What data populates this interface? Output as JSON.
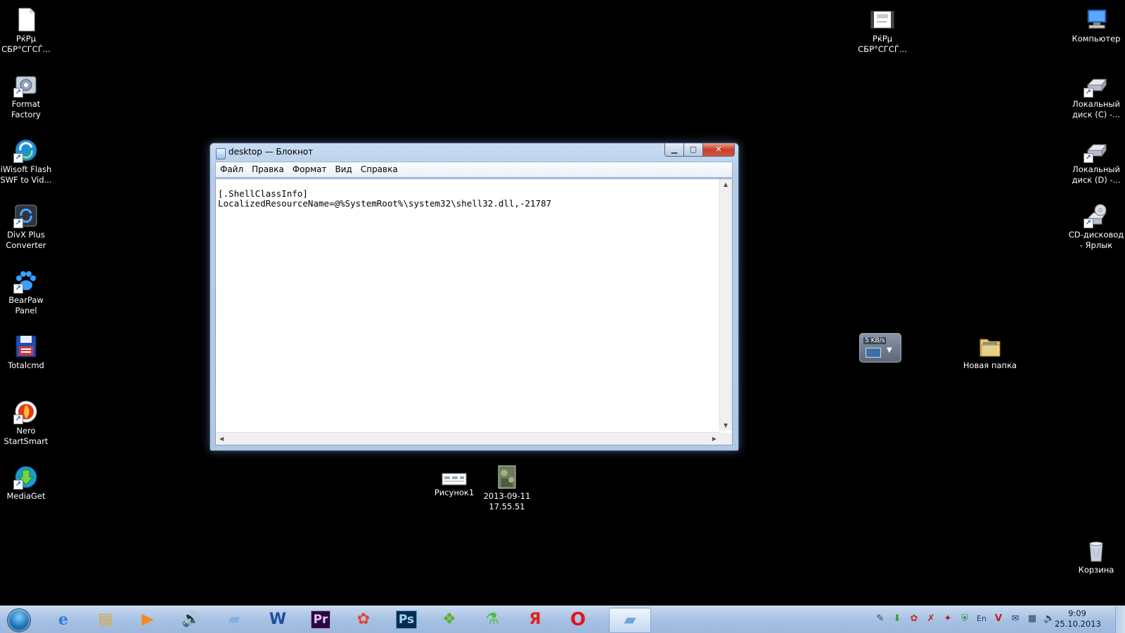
{
  "desktop_left": [
    {
      "label": "РќРµ СБР°СГСЃ...",
      "icon": "blank-file-icon"
    },
    {
      "label": "Format Factory",
      "icon": "format-factory-icon"
    },
    {
      "label": "iWisoft Flash SWF to Vid...",
      "icon": "iwisoft-icon"
    },
    {
      "label": "DivX Plus Converter",
      "icon": "divx-icon"
    },
    {
      "label": "BearPaw Panel",
      "icon": "bearpaw-icon"
    },
    {
      "label": "Totalcmd",
      "icon": "totalcmd-icon"
    },
    {
      "label": "Nero StartSmart",
      "icon": "nero-icon"
    },
    {
      "label": "MediaGet",
      "icon": "mediaget-icon"
    }
  ],
  "desktop_right": [
    {
      "label": "Компьютер",
      "icon": "computer-icon"
    },
    {
      "label": "Локальный диск (C) -...",
      "icon": "drive-c-icon"
    },
    {
      "label": "Локальный диск (D) -...",
      "icon": "drive-d-icon"
    },
    {
      "label": "CD-дисковод - Ярлык",
      "icon": "cd-drive-icon"
    },
    {
      "label": "Корзина",
      "icon": "recycle-bin-icon"
    }
  ],
  "desktop_misc": {
    "top_file": "РќРµ СБР°СГСЃ...",
    "new_folder": "Новая папка",
    "picture1": "Рисунок1",
    "photo": "2013-09-11 17.55.51",
    "gadget_speed": "5 KB/s"
  },
  "window": {
    "title": "desktop — Блокнот",
    "menu": [
      "Файл",
      "Правка",
      "Формат",
      "Вид",
      "Справка"
    ],
    "content_line1": "[.ShellClassInfo]",
    "content_line2": "LocalizedResourceName=@%SystemRoot%\\system32\\shell32.dll,-21787"
  },
  "taskbar": {
    "items": [
      {
        "name": "internet-explorer",
        "glyph": "e"
      },
      {
        "name": "explorer",
        "glyph": "▤"
      },
      {
        "name": "media-player",
        "glyph": "▶"
      },
      {
        "name": "volume-app",
        "glyph": "🔊"
      },
      {
        "name": "notepad-app",
        "glyph": "▰"
      },
      {
        "name": "word",
        "glyph": "W"
      },
      {
        "name": "premiere",
        "glyph": "Pr"
      },
      {
        "name": "picasa",
        "glyph": "✿"
      },
      {
        "name": "photoshop",
        "glyph": "Ps"
      },
      {
        "name": "app-green",
        "glyph": "❖"
      },
      {
        "name": "app-flask",
        "glyph": "⚗"
      },
      {
        "name": "yandex",
        "glyph": "Я"
      },
      {
        "name": "opera",
        "glyph": "O"
      },
      {
        "name": "notepad-active",
        "glyph": "▰"
      }
    ],
    "lang": "En",
    "time": "9:09",
    "date": "25.10.2013"
  }
}
